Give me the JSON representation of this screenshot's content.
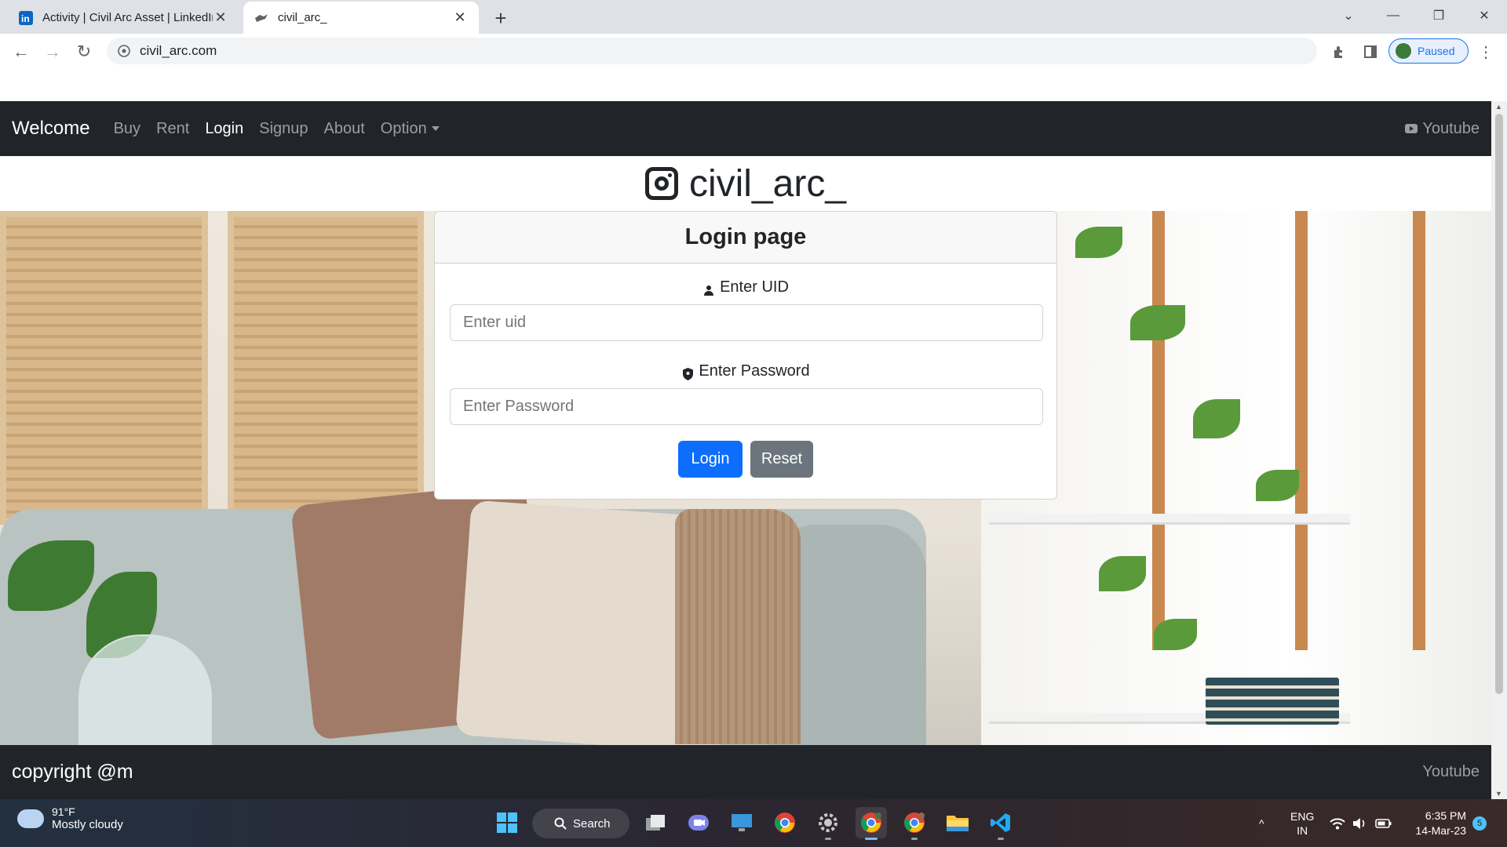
{
  "browser": {
    "tabs": [
      {
        "title": "Activity | Civil Arc Asset | LinkedIn",
        "favicon": "linkedin-icon",
        "active": false
      },
      {
        "title": "civil_arc_",
        "favicon": "bird-icon",
        "active": true
      }
    ],
    "url": "civil_arc.com",
    "profile_status": "Paused"
  },
  "navbar": {
    "brand": "Welcome",
    "links": [
      "Buy",
      "Rent",
      "Login",
      "Signup",
      "About",
      "Option"
    ],
    "active_link": "Login",
    "right_link": "Youtube"
  },
  "header": {
    "site_name": "civil_arc_",
    "icon": "instagram-icon"
  },
  "login": {
    "title": "Login page",
    "uid_label": "Enter UID",
    "uid_placeholder": "Enter uid",
    "password_label": "Enter Password",
    "password_placeholder": "Enter Password",
    "login_button": "Login",
    "reset_button": "Reset"
  },
  "footer": {
    "copyright": "copyright @m",
    "link": "Youtube"
  },
  "taskbar": {
    "weather_temp": "91°F",
    "weather_desc": "Mostly cloudy",
    "search_label": "Search",
    "language_line1": "ENG",
    "language_line2": "IN",
    "time": "6:35 PM",
    "date": "14-Mar-23",
    "notification_count": "5"
  },
  "colors": {
    "navbar_bg": "#212529",
    "primary": "#0d6efd",
    "secondary": "#6c757d"
  }
}
